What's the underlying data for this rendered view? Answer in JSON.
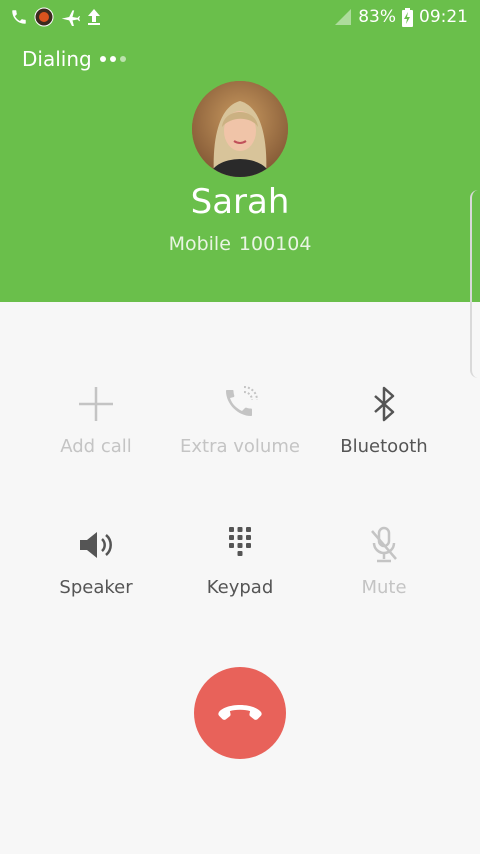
{
  "status_bar": {
    "battery": "83%",
    "time": "09:21",
    "icons": [
      "phone-icon",
      "notification-app-icon",
      "airplane-icon",
      "upload-icon",
      "signal-icon",
      "battery-charging-icon"
    ]
  },
  "call": {
    "status": "Dialing",
    "contact_name": "Sarah",
    "number_type": "Mobile",
    "number": "100104"
  },
  "controls": [
    {
      "label": "Add call",
      "icon": "plus-icon",
      "enabled": false
    },
    {
      "label": "Extra volume",
      "icon": "phone-volume-icon",
      "enabled": false
    },
    {
      "label": "Bluetooth",
      "icon": "bluetooth-icon",
      "enabled": true
    },
    {
      "label": "Speaker",
      "icon": "speaker-icon",
      "enabled": true
    },
    {
      "label": "Keypad",
      "icon": "keypad-icon",
      "enabled": true
    },
    {
      "label": "Mute",
      "icon": "mute-mic-icon",
      "enabled": false
    }
  ],
  "end_call": {
    "icon": "end-call-icon"
  },
  "colors": {
    "header_green": "#6abf4b",
    "end_call_red": "#e8625a",
    "enabled_icon": "#555555",
    "disabled_icon": "#c4c4c4"
  }
}
